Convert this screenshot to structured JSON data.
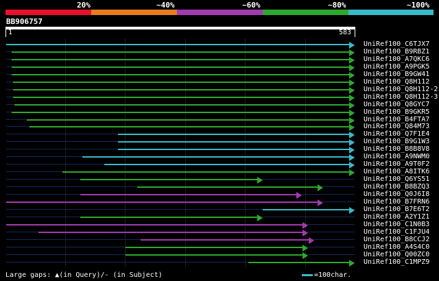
{
  "legend": {
    "labels": [
      "20%",
      "~40%",
      "~60%",
      "~80%",
      "~100%"
    ],
    "colors": [
      "#e8112d",
      "#e87c1e",
      "#a23ab0",
      "#2ea82e",
      "#3ab9c8"
    ]
  },
  "query": {
    "id": "BB906757",
    "start": "1",
    "end": "583"
  },
  "hits": [
    {
      "name": "UniRef100_C6TJX7",
      "color": "#3ab9c8",
      "start": 1,
      "end": 583
    },
    {
      "name": "UniRef100_B9RBZ1",
      "color": "#2ea82e",
      "start": 10,
      "end": 583
    },
    {
      "name": "UniRef100_A7QKC6",
      "color": "#2ea82e",
      "start": 10,
      "end": 583
    },
    {
      "name": "UniRef100_A9PGK5",
      "color": "#2ea82e",
      "start": 10,
      "end": 583
    },
    {
      "name": "UniRef100_B9GW41",
      "color": "#2ea82e",
      "start": 10,
      "end": 583
    },
    {
      "name": "UniRef100_Q8H112",
      "color": "#2ea82e",
      "start": 12,
      "end": 583
    },
    {
      "name": "UniRef100_Q8H112-2",
      "color": "#2ea82e",
      "start": 12,
      "end": 583
    },
    {
      "name": "UniRef100_Q8H112-3",
      "color": "#2ea82e",
      "start": 12,
      "end": 583
    },
    {
      "name": "UniRef100_Q8GYC7",
      "color": "#2ea82e",
      "start": 15,
      "end": 583
    },
    {
      "name": "UniRef100_B9GKR5",
      "color": "#2ea82e",
      "start": 10,
      "end": 583
    },
    {
      "name": "UniRef100_B4FTA7",
      "color": "#2ea82e",
      "start": 35,
      "end": 583
    },
    {
      "name": "UniRef100_Q84M73",
      "color": "#2ea82e",
      "start": 40,
      "end": 583
    },
    {
      "name": "UniRef100_Q7F1E4",
      "color": "#3ab9c8",
      "start": 188,
      "end": 583
    },
    {
      "name": "UniRef100_B9G1W3",
      "color": "#3ab9c8",
      "start": 188,
      "end": 583
    },
    {
      "name": "UniRef100_B8B8V8",
      "color": "#3ab9c8",
      "start": 188,
      "end": 583
    },
    {
      "name": "UniRef100_A9NWM0",
      "color": "#3ab9c8",
      "start": 128,
      "end": 583
    },
    {
      "name": "UniRef100_A9T0F2",
      "color": "#3ab9c8",
      "start": 165,
      "end": 583
    },
    {
      "name": "UniRef100_A8ITK6",
      "color": "#2ea82e",
      "start": 95,
      "end": 583
    },
    {
      "name": "UniRef100_Q6YS51",
      "color": "#2ea82e",
      "start": 125,
      "end": 430
    },
    {
      "name": "UniRef100_B8BZQ3",
      "color": "#2ea82e",
      "start": 220,
      "end": 530
    },
    {
      "name": "UniRef100_Q0J6I8",
      "color": "#a23ab0",
      "start": 125,
      "end": 495
    },
    {
      "name": "UniRef100_B7FRN6",
      "color": "#a23ab0",
      "start": 1,
      "end": 530
    },
    {
      "name": "UniRef100_B7E6T2",
      "color": "#3ab9c8",
      "start": 430,
      "end": 583
    },
    {
      "name": "UniRef100_A2Y1Z1",
      "color": "#2ea82e",
      "start": 125,
      "end": 430
    },
    {
      "name": "UniRef100_C1N0B3",
      "color": "#a23ab0",
      "start": 1,
      "end": 505
    },
    {
      "name": "UniRef100_C1FJU4",
      "color": "#a23ab0",
      "start": 55,
      "end": 505
    },
    {
      "name": "UniRef100_B8CCJ2",
      "color": "#a23ab0",
      "start": 225,
      "end": 515
    },
    {
      "name": "UniRef100_A4S4C0",
      "color": "#2ea82e",
      "start": 200,
      "end": 505
    },
    {
      "name": "UniRef100_Q00ZC0",
      "color": "#2ea82e",
      "start": 200,
      "end": 505
    },
    {
      "name": "UniRef100_C1MPZ9",
      "color": "#2ea82e",
      "start": 405,
      "end": 583
    }
  ],
  "footer": {
    "gap_legend": "Large gaps: ▲(in Query)/- (in Subject)",
    "scale_label": "=100char."
  }
}
